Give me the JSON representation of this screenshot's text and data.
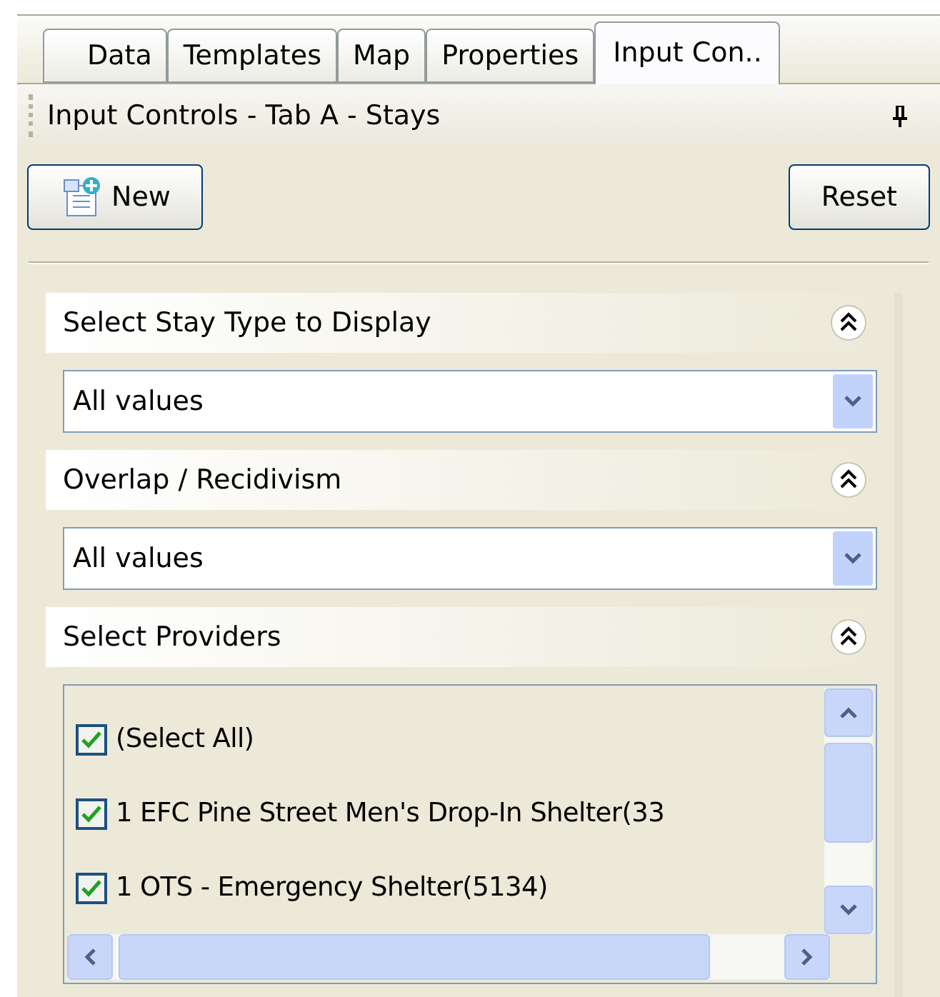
{
  "tabs": [
    {
      "label": "Data",
      "selected": false
    },
    {
      "label": "Templates",
      "selected": false
    },
    {
      "label": "Map",
      "selected": false
    },
    {
      "label": "Properties",
      "selected": false
    },
    {
      "label": "Input Con..",
      "selected": true
    }
  ],
  "panel": {
    "title": "Input Controls - Tab A - Stays"
  },
  "toolbar": {
    "new_button": "New",
    "reset_button": "Reset"
  },
  "sections": [
    {
      "kind": "dropdown",
      "title": "Select Stay Type to Display",
      "expanded": true,
      "value": "All values"
    },
    {
      "kind": "dropdown",
      "title": "Overlap / Recidivism",
      "expanded": true,
      "value": "All values"
    },
    {
      "kind": "checklist",
      "title": "Select Providers",
      "expanded": true,
      "items": [
        {
          "label": "(Select All)",
          "checked": true
        },
        {
          "label": "1 EFC Pine Street Men's Drop-In Shelter(33",
          "checked": true
        },
        {
          "label": "1 OTS - Emergency Shelter(5134)",
          "checked": true
        }
      ]
    }
  ]
}
